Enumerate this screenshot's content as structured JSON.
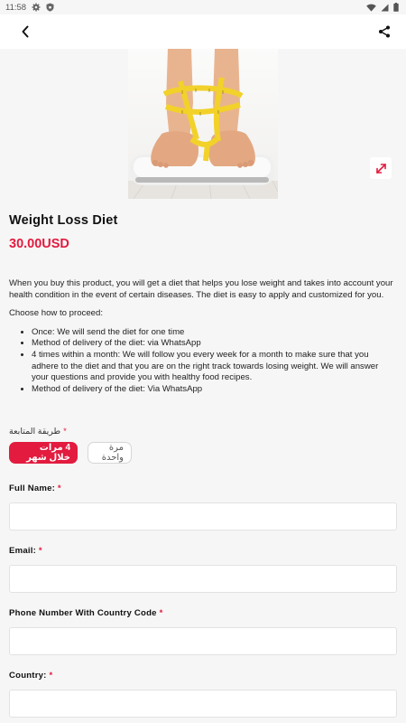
{
  "status_bar": {
    "time": "11:58"
  },
  "app_bar": {
    "back_icon": "back-arrow-icon",
    "share_icon": "share-icon"
  },
  "product": {
    "title": "Weight Loss Diet",
    "price": "30.00USD",
    "description": {
      "intro": "When you buy this product, you will get a diet that helps you lose weight and takes into account your health condition in the event of certain diseases. The diet is easy to apply and customized for you.",
      "choose": "Choose how to proceed:",
      "bullets": [
        "Once: We will send the diet for one time",
        "Method of delivery of the diet: via WhatsApp",
        "4 times within a month: We will follow you every week for a month to make sure that you adhere to the diet and that you are on the right track towards losing weight. We will answer your questions and provide you with healthy food recipes.",
        "Method of delivery of the diet: Via WhatsApp"
      ]
    }
  },
  "follow_up": {
    "label": "طريقة المتابعة",
    "required_mark": "*",
    "options": [
      {
        "label": "4 مرات خلال شهر",
        "selected": true
      },
      {
        "label": "مرة واحدة",
        "selected": false
      }
    ]
  },
  "form": {
    "full_name_label": "Full Name:",
    "email_label": "Email:",
    "phone_label": "Phone Number With Country Code",
    "country_label": "Country:",
    "required_mark": "*"
  },
  "colors": {
    "accent": "#e21b3f",
    "background": "#f6f6f6"
  }
}
